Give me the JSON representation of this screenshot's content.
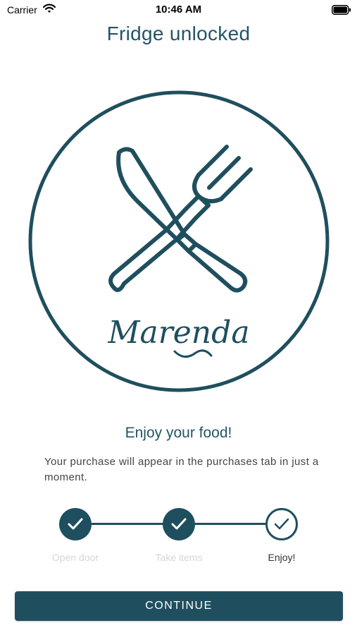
{
  "status_bar": {
    "carrier": "Carrier",
    "time": "10:46 AM"
  },
  "header": {
    "title": "Fridge unlocked"
  },
  "logo": {
    "brand_text": "Marenda",
    "icon": "knife-and-fork-icon"
  },
  "content": {
    "heading": "Enjoy your food!",
    "message": "Your purchase will appear in the purchases tab in just a moment."
  },
  "steps": [
    {
      "label": "Open door",
      "state": "done"
    },
    {
      "label": "Take items",
      "state": "done"
    },
    {
      "label": "Enjoy!",
      "state": "current"
    }
  ],
  "actions": {
    "continue_label": "CONTINUE"
  },
  "colors": {
    "brand": "#1f4f5e",
    "muted_label": "#d6d6d6",
    "background": "#ffffff"
  }
}
